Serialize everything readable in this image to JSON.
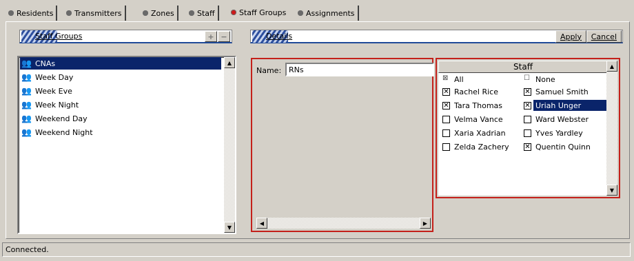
{
  "tabs": [
    {
      "label": "Residents",
      "active": false
    },
    {
      "label": "Transmitters",
      "active": false
    },
    {
      "label": "Zones",
      "active": false
    },
    {
      "label": "Staff",
      "active": false
    },
    {
      "label": "Staff Groups",
      "active": true
    },
    {
      "label": "Assignments",
      "active": false
    }
  ],
  "left_panel": {
    "title": "Staff Groups",
    "add_label": "+",
    "remove_label": "−",
    "groups": [
      {
        "label": "CNAs",
        "selected": true,
        "icon": "group-icon"
      },
      {
        "label": "Week Day",
        "selected": false,
        "icon": "group-icon"
      },
      {
        "label": "Week Eve",
        "selected": false,
        "icon": "group-icon"
      },
      {
        "label": "Week Night",
        "selected": false,
        "icon": "group-icon"
      },
      {
        "label": "Weekend Day",
        "selected": false,
        "icon": "group-icon"
      },
      {
        "label": "Weekend Night",
        "selected": false,
        "icon": "group-icon"
      }
    ]
  },
  "details": {
    "title": "Details",
    "apply_label": "Apply",
    "cancel_label": "Cancel",
    "name_label": "Name:",
    "name_value": "RNs",
    "staff": {
      "header": "Staff",
      "all_label": "All",
      "none_label": "None",
      "rows": [
        [
          {
            "name": "Rachel Rice",
            "checked": true,
            "selected": false
          },
          {
            "name": "Samuel Smith",
            "checked": true,
            "selected": false
          }
        ],
        [
          {
            "name": "Tara Thomas",
            "checked": true,
            "selected": false
          },
          {
            "name": "Uriah Unger",
            "checked": true,
            "selected": true
          }
        ],
        [
          {
            "name": "Velma Vance",
            "checked": false,
            "selected": false
          },
          {
            "name": "Ward Webster",
            "checked": false,
            "selected": false
          }
        ],
        [
          {
            "name": "Xaria Xadrian",
            "checked": false,
            "selected": false
          },
          {
            "name": "Yves Yardley",
            "checked": false,
            "selected": false
          }
        ],
        [
          {
            "name": "Zelda Zachery",
            "checked": false,
            "selected": false
          },
          {
            "name": "Quentin Quinn",
            "checked": true,
            "selected": false
          }
        ]
      ]
    }
  },
  "status": {
    "text": "Connected."
  },
  "colors": {
    "selection": "#0a246a",
    "accent_red": "#c4201a",
    "header_blue": "#1f4a98"
  }
}
